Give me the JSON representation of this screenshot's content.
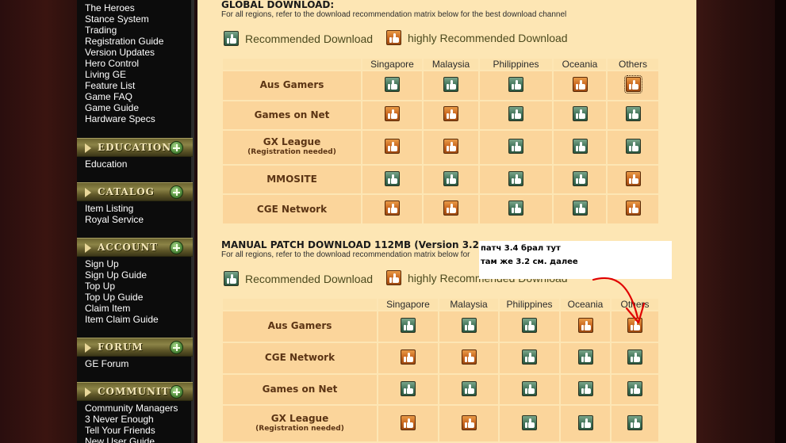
{
  "sidebar": {
    "top_links": [
      "The Heroes",
      "Stance System",
      "Trading",
      "Registration Guide",
      "Version Updates",
      "Hero Control",
      "Living GE",
      "Feature List",
      "Game FAQ",
      "Game Guide",
      "Hardware Specs"
    ],
    "sections": [
      {
        "title": "EDUCATION",
        "links": [
          "Education"
        ]
      },
      {
        "title": "CATALOG",
        "links": [
          "Item Listing",
          "Royal Service"
        ]
      },
      {
        "title": "ACCOUNT",
        "links": [
          "Sign Up",
          "Sign Up Guide",
          "Top Up",
          "Top Up Guide",
          "Claim Item",
          "Item Claim Guide"
        ]
      },
      {
        "title": "FORUM",
        "links": [
          "GE Forum"
        ]
      },
      {
        "title": "COMMUNITY",
        "links": [
          "Community Managers",
          "3 Never Enough",
          "Tell Your Friends",
          "New User Guide"
        ]
      }
    ]
  },
  "legend": {
    "recommended": "Recommended Download",
    "highly": "highly Recommended Download"
  },
  "global": {
    "title": "GLOBAL DOWNLOAD:",
    "subtitle": "For all regions, refer to the download recommendation matrix below for the best download channel",
    "columns": [
      "Singapore",
      "Malaysia",
      "Philippines",
      "Oceania",
      "Others"
    ],
    "rows": [
      {
        "name": "Aus Gamers",
        "note": "",
        "cells": [
          "green",
          "green",
          "green",
          "orange",
          "orange"
        ]
      },
      {
        "name": "Games on Net",
        "note": "",
        "cells": [
          "orange",
          "orange",
          "green",
          "green",
          "green"
        ]
      },
      {
        "name": "GX League",
        "note": "(Registration needed)",
        "cells": [
          "orange",
          "orange",
          "green",
          "green",
          "green"
        ]
      },
      {
        "name": "MMOSITE",
        "note": "",
        "cells": [
          "green",
          "green",
          "green",
          "green",
          "orange"
        ]
      },
      {
        "name": "CGE Network",
        "note": "",
        "cells": [
          "orange",
          "orange",
          "green",
          "green",
          "orange"
        ]
      }
    ]
  },
  "manual": {
    "title": "MANUAL PATCH DOWNLOAD 112MB (Version 3.2 to V",
    "subtitle": "For all regions, refer to the download recommendation matrix below for",
    "columns": [
      "Singapore",
      "Malaysia",
      "Philippines",
      "Oceania",
      "Others"
    ],
    "rows": [
      {
        "name": "Aus Gamers",
        "note": "",
        "cells": [
          "green",
          "green",
          "green",
          "orange",
          "orange"
        ]
      },
      {
        "name": "CGE Network",
        "note": "",
        "cells": [
          "orange",
          "orange",
          "green",
          "green",
          "green"
        ]
      },
      {
        "name": "Games on Net",
        "note": "",
        "cells": [
          "green",
          "green",
          "green",
          "green",
          "green"
        ]
      },
      {
        "name": "GX League",
        "note": "(Registration needed)",
        "cells": [
          "orange",
          "orange",
          "green",
          "green",
          "green"
        ]
      }
    ]
  },
  "overlay_note": {
    "line1": "патч 3.4 брал тут",
    "line2": "там же 3.2 см. далее"
  },
  "colors": {
    "recommended_icon": "#3f7258",
    "highly_icon": "#c7641c",
    "arrow": "#e00000"
  }
}
